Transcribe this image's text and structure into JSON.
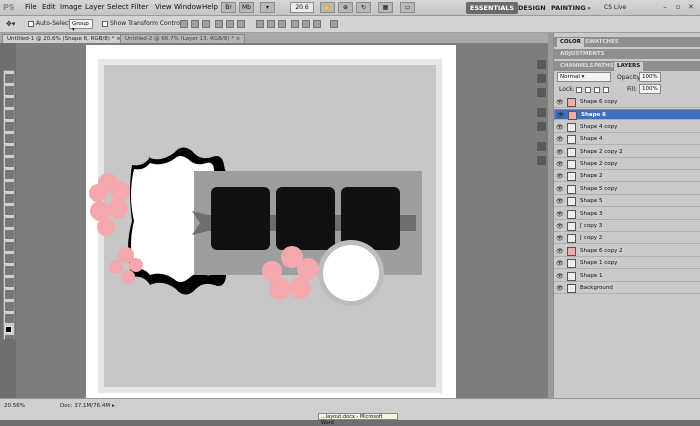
{
  "app": {
    "logo": "PS",
    "menus": [
      "File",
      "Edit",
      "Image",
      "Layer",
      "Select",
      "Filter",
      "View",
      "Window",
      "Help"
    ],
    "zoom_field": "20.6"
  },
  "workspaces": {
    "essentials": "ESSENTIALS",
    "design": "DESIGN",
    "painting": "PAINTING",
    "cs_live": "CS Live"
  },
  "options": {
    "auto_select_label": "Auto-Select:",
    "auto_select_value": "Group",
    "transform_label": "Show Transform Controls"
  },
  "tabs": [
    {
      "label": "Untitled-1 @ 20.6% (Shape 6, RGB/8) *",
      "active": true
    },
    {
      "label": "Untitled-2 @ 66.7% (Layer 13, RGB/8) *",
      "active": false
    }
  ],
  "status": {
    "zoom": "20.56%",
    "doc": "Doc: 37.1M/76.4M"
  },
  "taskbar_tip": "...layout.docx - Microsoft Word",
  "panels": {
    "color_tab": "COLOR",
    "swatches_tab": "SWATCHES",
    "adjustments_tab": "ADJUSTMENTS",
    "channels_tab": "CHANNELS",
    "paths_tab": "PATHS",
    "layers_tab": "LAYERS",
    "blend_mode": "Normal",
    "opacity_label": "Opacity:",
    "opacity_value": "100%",
    "lock_label": "Lock:",
    "fill_label": "Fill:",
    "fill_value": "100%"
  },
  "layers": [
    {
      "name": "Shape 6 copy",
      "selected": false,
      "thumb": "pink"
    },
    {
      "name": "Shape 6",
      "selected": true,
      "thumb": "pink"
    },
    {
      "name": "Shape 4 copy",
      "selected": false,
      "thumb": "white"
    },
    {
      "name": "Shape 4",
      "selected": false,
      "thumb": "white"
    },
    {
      "name": "Shape 2 copy 2",
      "selected": false,
      "thumb": "white"
    },
    {
      "name": "Shape 2 copy",
      "selected": false,
      "thumb": "white"
    },
    {
      "name": "Shape 2",
      "selected": false,
      "thumb": "white"
    },
    {
      "name": "Shape 5 copy",
      "selected": false,
      "thumb": "white"
    },
    {
      "name": "Shape 5",
      "selected": false,
      "thumb": "white"
    },
    {
      "name": "Shape 3",
      "selected": false,
      "thumb": "white"
    },
    {
      "name": "[ copy 3",
      "selected": false,
      "thumb": "white"
    },
    {
      "name": "[ copy 2",
      "selected": false,
      "thumb": "white"
    },
    {
      "name": "Shape 6 copy 2",
      "selected": false,
      "thumb": "pink"
    },
    {
      "name": "Shape 1 copy",
      "selected": false,
      "thumb": "white"
    },
    {
      "name": "Shape 1",
      "selected": false,
      "thumb": "white"
    },
    {
      "name": "Background",
      "selected": false,
      "thumb": "white"
    }
  ],
  "colors": {
    "selected_layer": "#3f6fc4",
    "flower_pink": "#f4a7ad",
    "photo_slot": "#111111"
  }
}
